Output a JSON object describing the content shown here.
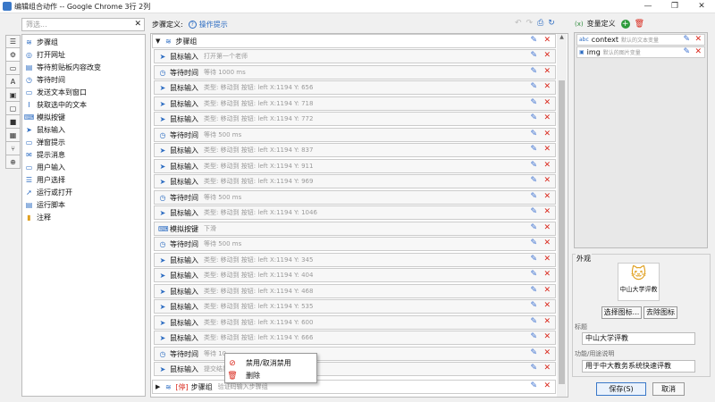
{
  "window": {
    "title": "编辑组合动作 -- Google Chrome 3行 2列",
    "controls": [
      "—",
      "❐",
      "✕"
    ]
  },
  "left_tabs": [
    "☰",
    "⚙",
    "▭",
    "A",
    "▣",
    "▢",
    "■",
    "▦",
    "⑂",
    "⊕"
  ],
  "filter": {
    "placeholder": "筛选..."
  },
  "tree": [
    {
      "icon": "≋",
      "label": "步骤组"
    },
    {
      "icon": "◎",
      "label": "打开网址"
    },
    {
      "icon": "▤",
      "label": "等待剪贴板内容改变"
    },
    {
      "icon": "◷",
      "label": "等待时间"
    },
    {
      "icon": "▭",
      "label": "发送文本到窗口"
    },
    {
      "icon": "I",
      "label": "获取选中的文本"
    },
    {
      "icon": "⌨",
      "label": "模拟按键"
    },
    {
      "icon": "➤",
      "label": "鼠标输入"
    },
    {
      "icon": "▭",
      "label": "弹窗提示"
    },
    {
      "icon": "✉",
      "label": "提示消息"
    },
    {
      "icon": "▭",
      "label": "用户输入"
    },
    {
      "icon": "☰",
      "label": "用户选择"
    },
    {
      "icon": "➚",
      "label": "运行或打开"
    },
    {
      "icon": "▤",
      "label": "运行脚本"
    },
    {
      "icon": "▮",
      "label": "注释"
    }
  ],
  "steps_header": {
    "label": "步骤定义:",
    "hint_icon": "?",
    "hint": "操作提示",
    "tools": [
      "↶",
      "↷",
      "⎙",
      "↻"
    ]
  },
  "steps": [
    {
      "type": "group",
      "icon": "≋",
      "name": "步骤组",
      "desc": ""
    },
    {
      "icon": "➤",
      "name": "鼠标输入",
      "desc": "打开第一个老师"
    },
    {
      "icon": "◷",
      "name": "等待时间",
      "desc": "等待 1000 ms"
    },
    {
      "icon": "➤",
      "name": "鼠标输入",
      "desc": "类型: 移动到  按钮: left  X:1194  Y: 656"
    },
    {
      "icon": "➤",
      "name": "鼠标输入",
      "desc": "类型: 移动到  按钮: left  X:1194  Y: 718"
    },
    {
      "icon": "➤",
      "name": "鼠标输入",
      "desc": "类型: 移动到  按钮: left  X:1194  Y: 772"
    },
    {
      "icon": "◷",
      "name": "等待时间",
      "desc": "等待 500 ms"
    },
    {
      "icon": "➤",
      "name": "鼠标输入",
      "desc": "类型: 移动到  按钮: left  X:1194  Y: 837"
    },
    {
      "icon": "➤",
      "name": "鼠标输入",
      "desc": "类型: 移动到  按钮: left  X:1194  Y: 911"
    },
    {
      "icon": "➤",
      "name": "鼠标输入",
      "desc": "类型: 移动到  按钮: left  X:1194  Y: 969"
    },
    {
      "icon": "◷",
      "name": "等待时间",
      "desc": "等待 500 ms"
    },
    {
      "icon": "➤",
      "name": "鼠标输入",
      "desc": "类型: 移动到  按钮: left  X:1194  Y: 1046"
    },
    {
      "icon": "⌨",
      "name": "模拟按键",
      "desc": "下滑"
    },
    {
      "icon": "◷",
      "name": "等待时间",
      "desc": "等待 500 ms"
    },
    {
      "icon": "➤",
      "name": "鼠标输入",
      "desc": "类型: 移动到  按钮: left  X:1194  Y: 345"
    },
    {
      "icon": "➤",
      "name": "鼠标输入",
      "desc": "类型: 移动到  按钮: left  X:1194  Y: 404"
    },
    {
      "icon": "➤",
      "name": "鼠标输入",
      "desc": "类型: 移动到  按钮: left  X:1194  Y: 468"
    },
    {
      "icon": "➤",
      "name": "鼠标输入",
      "desc": "类型: 移动到  按钮: left  X:1194  Y: 535"
    },
    {
      "icon": "➤",
      "name": "鼠标输入",
      "desc": "类型: 移动到  按钮: left  X:1194  Y: 600"
    },
    {
      "icon": "➤",
      "name": "鼠标输入",
      "desc": "类型: 移动到  按钮: left  X:1194  Y: 666"
    },
    {
      "icon": "◷",
      "name": "等待时间",
      "desc": "等待 10"
    },
    {
      "icon": "➤",
      "name": "鼠标输入",
      "desc": "提交结果"
    },
    {
      "type": "group-disabled",
      "icon": "≋",
      "name": "步骤组",
      "prefix": "[停]",
      "desc": "验证码输入步骤组"
    }
  ],
  "context_menu": {
    "items": [
      {
        "icon": "⊘",
        "label": "禁用/取消禁用"
      },
      {
        "icon": "🗑",
        "label": "删除"
      }
    ]
  },
  "variables": {
    "header_icon": "(x)",
    "title": "变量定义",
    "add": "+",
    "delete": "🗑",
    "items": [
      {
        "icon": "abc",
        "name": "context",
        "desc": "默认的文本变量"
      },
      {
        "icon": "▣",
        "name": "img",
        "desc": "默认的图片变量"
      }
    ]
  },
  "appearance": {
    "legend": "外观",
    "icon_emoji": "🐱",
    "icon_caption": "中山大学评教",
    "choose_icon": "选择图标...",
    "remove_icon": "去除图标",
    "title_label": "标题",
    "title_value": "中山大学评教",
    "desc_label": "功能/用途说明",
    "desc_value": "用于中大教务系统快速评教"
  },
  "footer": {
    "save": "保存(S)",
    "cancel": "取消"
  }
}
